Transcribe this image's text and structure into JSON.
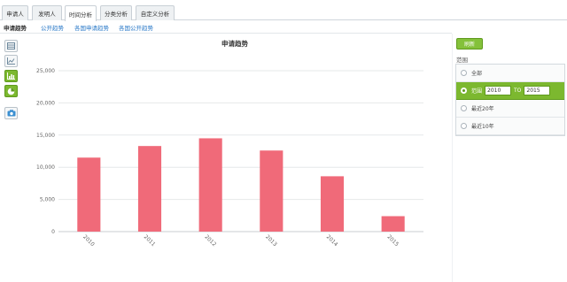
{
  "tabs": [
    {
      "label": "申请人",
      "active": false
    },
    {
      "label": "发明人",
      "active": false
    },
    {
      "label": "时间分析",
      "active": true
    },
    {
      "label": "分类分析",
      "active": false
    },
    {
      "label": "自定义分析",
      "active": false
    }
  ],
  "subtabs": [
    {
      "label": "申请趋势",
      "active": true
    },
    {
      "label": "公开趋势",
      "active": false
    },
    {
      "label": "各国申请趋势",
      "active": false
    },
    {
      "label": "各国公开趋势",
      "active": false
    }
  ],
  "toolbar": {
    "icons": [
      "table-icon",
      "line-chart-icon",
      "bar-chart-icon",
      "pie-chart-icon",
      "camera-icon"
    ],
    "active_index": 2
  },
  "chart_data": {
    "type": "bar",
    "title": "申请趋势",
    "xlabel": "",
    "ylabel": "",
    "categories": [
      "2010",
      "2011",
      "2012",
      "2013",
      "2014",
      "2015"
    ],
    "values": [
      11500,
      13300,
      14500,
      12600,
      8600,
      2400
    ],
    "ylim": [
      0,
      25000
    ],
    "y_ticks": [
      "0",
      "5,000",
      "10,000",
      "15,000",
      "20,000",
      "25,000"
    ],
    "bar_color": "#f06a79",
    "grid": true
  },
  "panel": {
    "refresh_label": "刷新",
    "range_label": "范围",
    "options": [
      {
        "label": "全部",
        "selected": false
      },
      {
        "label": "范围",
        "selected": true,
        "from_value": "2010",
        "to_label": "TO",
        "to_value": "2015"
      },
      {
        "label": "最近20年",
        "selected": false
      },
      {
        "label": "最近10年",
        "selected": false
      }
    ]
  },
  "colors": {
    "accent": "#7cb82f",
    "link": "#2a79c8",
    "bar": "#f06a79"
  }
}
